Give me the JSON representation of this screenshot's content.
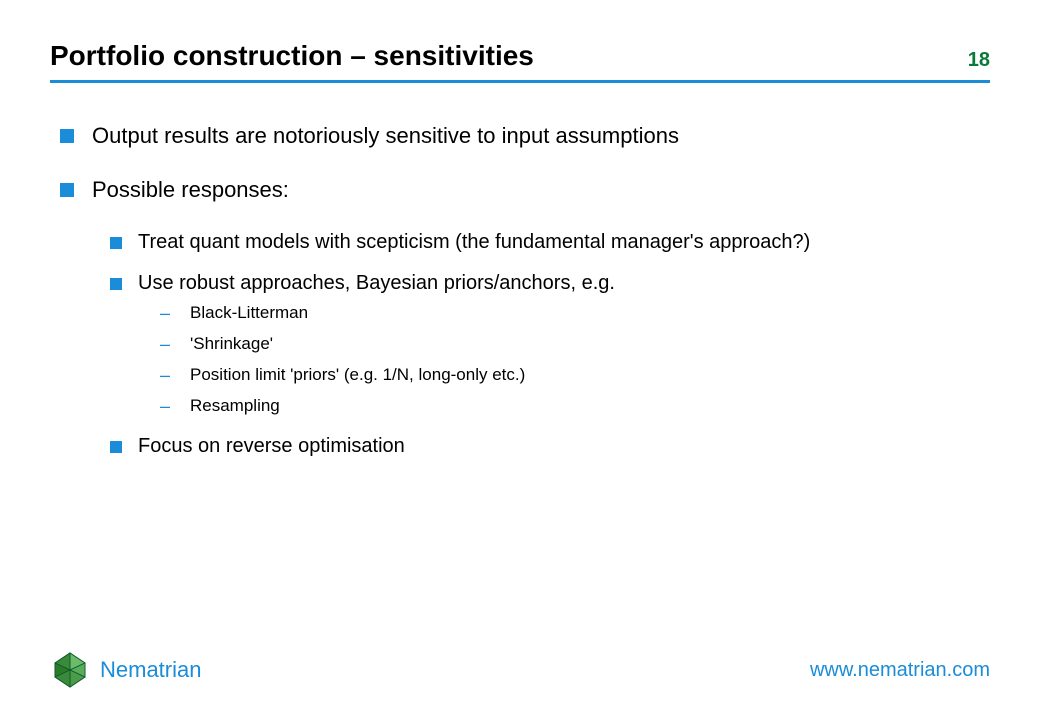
{
  "header": {
    "title": "Portfolio construction – sensitivities",
    "page_number": "18"
  },
  "bullets": {
    "b1": "Output results are notoriously sensitive to input assumptions",
    "b2": "Possible responses:",
    "b2_1": "Treat quant models with scepticism (the fundamental manager's approach?)",
    "b2_2": "Use robust approaches, Bayesian priors/anchors, e.g.",
    "b2_2_1": "Black-Litterman",
    "b2_2_2": "'Shrinkage'",
    "b2_2_3": "Position limit 'priors' (e.g. 1/N, long-only etc.)",
    "b2_2_4": "Resampling",
    "b2_3": "Focus on reverse optimisation"
  },
  "footer": {
    "brand": "Nematrian",
    "website": "www.nematrian.com"
  }
}
